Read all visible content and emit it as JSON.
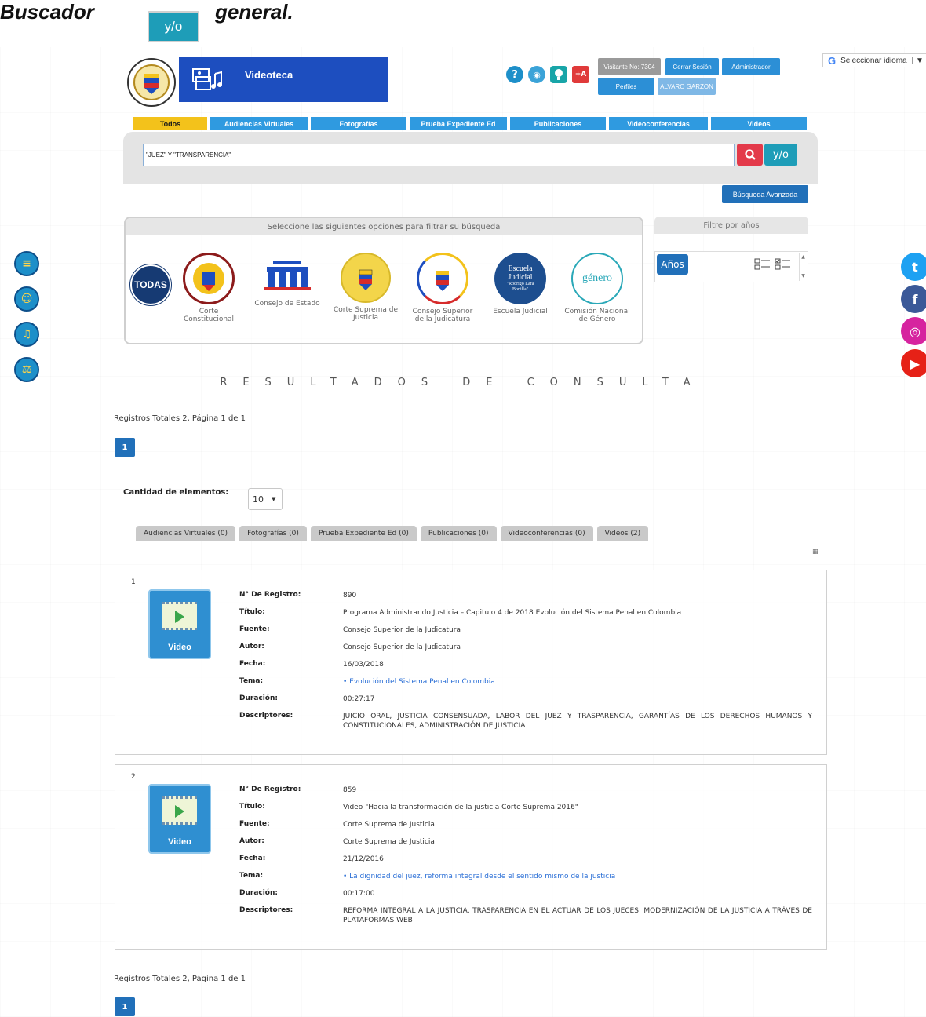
{
  "doc_title": {
    "word1": "Buscador",
    "badge": "y/o",
    "word2": "general."
  },
  "header": {
    "banner_title": "Videoteca",
    "visitors": "Visitante No: 7304",
    "logout": "Cerrar Sesión",
    "admin": "Administrador",
    "profiles": "Perfiles",
    "user": "ALVARO GARZON",
    "help_icon": "?",
    "plus_a": "+A",
    "language": "Seleccionar idioma",
    "language_sep": "|  ▼"
  },
  "categories": [
    {
      "label": "Todos",
      "width": 94,
      "active": true
    },
    {
      "label": "Audiencias Virtuales",
      "width": 124
    },
    {
      "label": "Fotografías",
      "width": 122
    },
    {
      "label": "Prueba Expediente Ed",
      "width": 124
    },
    {
      "label": "Publicaciones",
      "width": 122
    },
    {
      "label": "Videoconferencias",
      "width": 126
    },
    {
      "label": "Videos",
      "width": 122
    }
  ],
  "search": {
    "value": "\"JUEZ\" Y \"TRANSPARENCIA\"",
    "yo_label": "y/o",
    "advanced_label": "Búsqueda Avanzada"
  },
  "filters": {
    "header": "Seleccione las siguientes opciones para filtrar su búsqueda",
    "entities": [
      {
        "label": "TODAS"
      },
      {
        "label": "Corte Constitucional"
      },
      {
        "label": "Consejo de Estado"
      },
      {
        "label": "Corte Suprema de Justicia"
      },
      {
        "label": "Consejo Superior de la Judicatura"
      },
      {
        "label": "Escuela Judicial"
      },
      {
        "label": "Comisión Nacional de Género"
      }
    ],
    "escuela_logo_text": [
      "Escuela",
      "Judicial",
      "\"Rodrigo Lara",
      "Bonilla\""
    ],
    "genero_logo_text": "género"
  },
  "year_filter": {
    "header": "Filtre por años",
    "button": "Años"
  },
  "results": {
    "title": "RESULTADOS DE CONSULTA",
    "total_text": "Registros Totales 2, Página 1 de 1",
    "page": "1",
    "qty_label": "Cantidad de elementos:",
    "qty_value": "10",
    "type_tabs": [
      "Audiencias Virtuales (0)",
      "Fotografías (0)",
      "Prueba Expediente Ed (0)",
      "Publicaciones (0)",
      "Videoconferencias (0)",
      "Videos (2)"
    ],
    "labels": {
      "registro": "N° De Registro:",
      "titulo": "Título:",
      "fuente": "Fuente:",
      "autor": "Autor:",
      "fecha": "Fecha:",
      "tema": "Tema:",
      "duracion": "Duración:",
      "descriptores": "Descriptores:"
    },
    "video_label": "Video",
    "items": [
      {
        "index": "1",
        "registro": "890",
        "titulo": "Programa Administrando Justicia – Capitulo 4 de 2018 Evolución del Sistema Penal en Colombia",
        "fuente": "Consejo Superior de la Judicatura",
        "autor": "Consejo Superior de la Judicatura",
        "fecha": "16/03/2018",
        "tema": "• Evolución del Sistema Penal en Colombia",
        "duracion": "00:27:17",
        "descriptores": "JUICIO ORAL, JUSTICIA CONSENSUADA, LABOR DEL JUEZ Y TRASPARENCIA, GARANTÍAS DE LOS DERECHOS HUMANOS Y CONSTITUCIONALES, ADMINISTRACIÓN DE JUSTICIA"
      },
      {
        "index": "2",
        "registro": "859",
        "titulo": "Video \"Hacia la transformación de la justicia Corte Suprema 2016\"",
        "fuente": "Corte Suprema de Justicia",
        "autor": "Corte Suprema de Justicia",
        "fecha": "21/12/2016",
        "tema": "• La dignidad del juez, reforma integral desde el sentido mismo de la justicia",
        "duracion": "00:17:00",
        "descriptores": "REFORMA INTEGRAL A LA JUSTICIA, TRASPARENCIA EN EL ACTUAR DE LOS JUECES, MODERNIZACIÓN DE LA JUSTICIA A TRÁVES DE PLATAFORMAS WEB"
      }
    ]
  },
  "social": [
    {
      "name": "twitter-icon",
      "glyph": "t",
      "color": "#1da1f2"
    },
    {
      "name": "facebook-icon",
      "glyph": "f",
      "color": "#3b5998"
    },
    {
      "name": "instagram-icon",
      "glyph": "◎",
      "color": "#d6249f"
    },
    {
      "name": "youtube-icon",
      "glyph": "▶",
      "color": "#e62117"
    }
  ]
}
